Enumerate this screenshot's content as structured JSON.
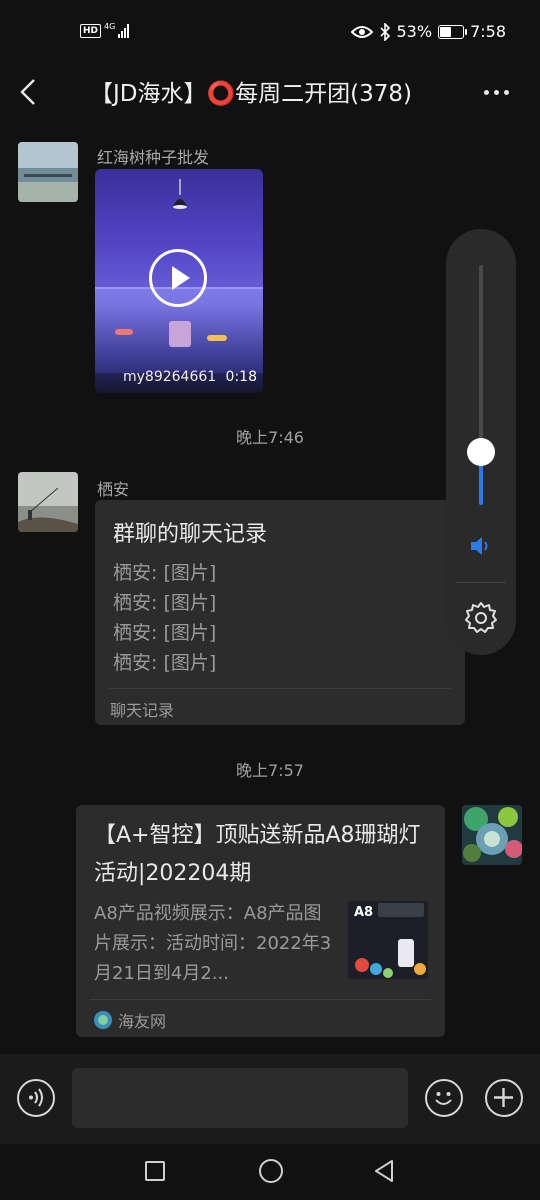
{
  "status_bar": {
    "network_hd": "HD",
    "network_type": "4G",
    "battery_percent": "53%",
    "battery_level": 0.53,
    "time": "7:58"
  },
  "header": {
    "title": "【JD海水】⭕每周二开团(378)"
  },
  "messages": [
    {
      "sender": "红海树种子批发",
      "video_watermark": "my89264661",
      "video_duration": "0:18"
    },
    {
      "timestamp": "晚上7:46"
    },
    {
      "sender": "栖安",
      "chat_record": {
        "title": "群聊的聊天记录",
        "lines": [
          "栖安: [图片]",
          "栖安: [图片]",
          "栖安: [图片]",
          "栖安: [图片]"
        ],
        "footer": "聊天记录"
      }
    },
    {
      "timestamp": "晚上7:57"
    },
    {
      "link_card": {
        "title": "【A+智控】顶贴送新品A8珊瑚灯活动|202204期",
        "description": "A8产品视频展示：A8产品图片展示：活动时间：2022年3月21日到4月2...",
        "thumbnail_label": "A8",
        "source": "海友网"
      }
    }
  ],
  "volume_panel": {
    "level": 0.22
  },
  "colors": {
    "accent": "#2a7bea",
    "background": "#111111",
    "bubble": "#2c2c2c"
  }
}
